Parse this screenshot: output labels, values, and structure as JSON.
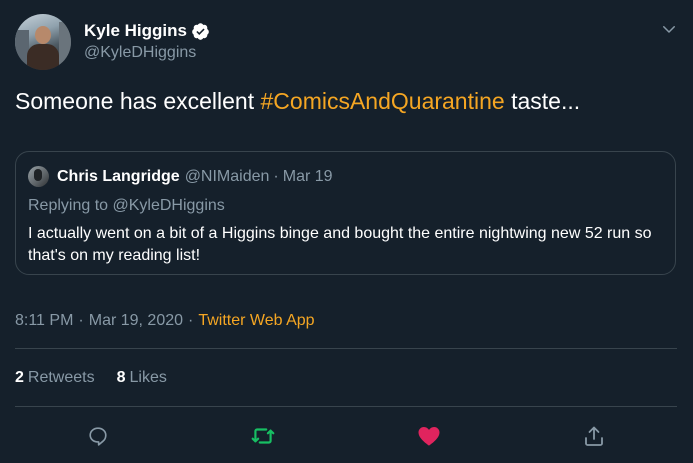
{
  "author": {
    "name": "Kyle Higgins",
    "handle": "@KyleDHiggins",
    "verified": true,
    "avatar_icon": "user-avatar-photo"
  },
  "tweet": {
    "text_before": "Someone has excellent ",
    "hashtag": "#ComicsAndQuarantine",
    "text_after": " taste..."
  },
  "quoted": {
    "name": "Chris Langridge",
    "handle": "@NIMaiden",
    "separator": "·",
    "date": "Mar 19",
    "replying_prefix": "Replying to ",
    "replying_handle": "@KyleDHiggins",
    "text": "I actually went on a bit of a Higgins binge and bought the entire nightwing new 52 run so that's on my reading list!"
  },
  "meta": {
    "time": "8:11 PM",
    "separator": "·",
    "date": "Mar 19, 2020",
    "source": "Twitter Web App"
  },
  "stats": {
    "retweets_count": "2",
    "retweets_label": "Retweets",
    "likes_count": "8",
    "likes_label": "Likes"
  },
  "actions": [
    "reply-icon",
    "retweet-icon",
    "like-icon",
    "share-icon"
  ],
  "colors": {
    "background": "#15202b",
    "secondary_text": "#8899a6",
    "accent": "#f5a623",
    "border": "#38444d",
    "retweet_active": "#17bf63",
    "like_active": "#e0245e"
  }
}
